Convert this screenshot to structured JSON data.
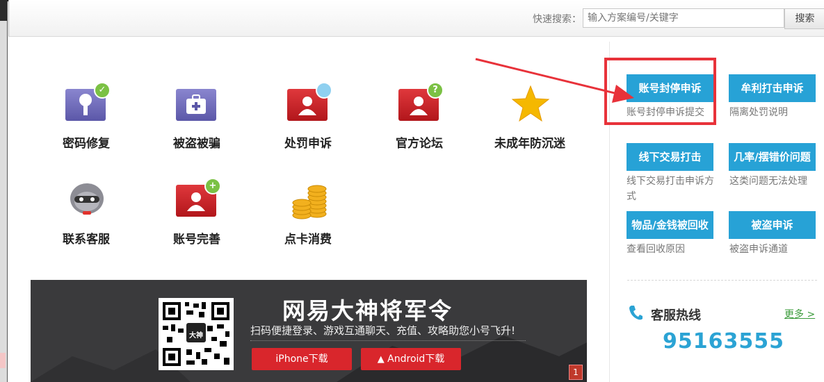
{
  "search": {
    "label": "快速搜索：",
    "placeholder": "输入方案编号/关键字",
    "button": "搜索"
  },
  "tiles": [
    {
      "label": "密码修复",
      "icon": "key-card-icon"
    },
    {
      "label": "被盗被骗",
      "icon": "medkit-icon"
    },
    {
      "label": "处罚申诉",
      "icon": "user-search-icon"
    },
    {
      "label": "官方论坛",
      "icon": "user-question-icon"
    },
    {
      "label": "未成年防沉迷",
      "icon": "star-icon"
    },
    {
      "label": "联系客服",
      "icon": "support-agent-icon"
    },
    {
      "label": "账号完善",
      "icon": "user-add-icon"
    },
    {
      "label": "点卡消费",
      "icon": "coins-icon"
    }
  ],
  "banner": {
    "title": "网易大神将军令",
    "subtitle": "扫码便捷登录、游戏互通聊天、充值、攻略助您小号飞升!",
    "iphone_button": "iPhone下载",
    "android_button": "Android下载",
    "qr_center": "大神",
    "page_number": "1"
  },
  "sidebar": {
    "services": [
      {
        "button": "账号封停申诉",
        "desc": "账号封停申诉提交"
      },
      {
        "button": "牟利打击申诉",
        "desc": "隔离处罚说明"
      },
      {
        "button": "线下交易打击",
        "desc": "线下交易打击申诉方式"
      },
      {
        "button": "几率/摆错价问题",
        "desc": "这类问题无法处理"
      },
      {
        "button": "物品/金钱被回收",
        "desc": "查看回收原因"
      },
      {
        "button": "被盗申诉",
        "desc": "被盗申诉通道"
      }
    ],
    "hotline_title": "客服热线",
    "more": "更多 >",
    "hotline_number": "95163555"
  },
  "colors": {
    "accent": "#27a2d6",
    "highlight": "#e8323a",
    "hotline": "#2ba3d4"
  }
}
